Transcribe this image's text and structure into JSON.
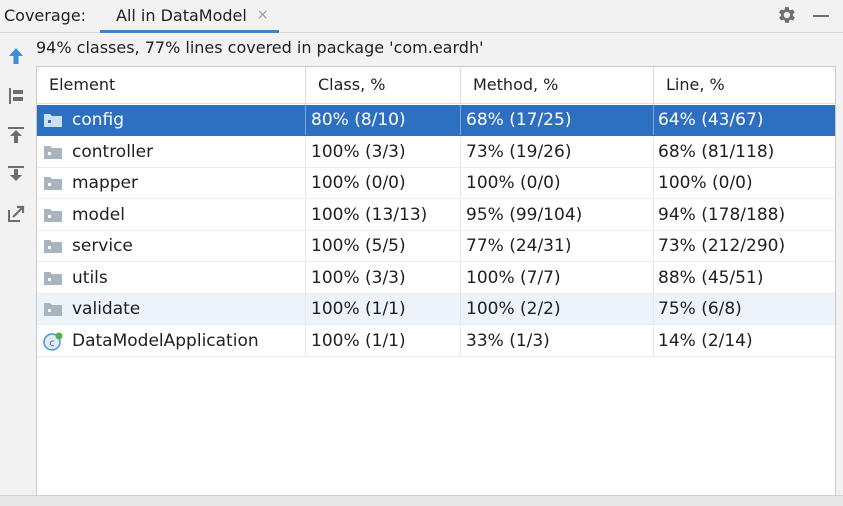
{
  "toolbar": {
    "label": "Coverage:",
    "tab_label": "All in DataModel",
    "tab_close": "×"
  },
  "summary": "94% classes, 77% lines covered in package 'com.eardh'",
  "table": {
    "columns": [
      "Element",
      "Class, %",
      "Method, %",
      "Line, %"
    ],
    "rows": [
      {
        "name": "config",
        "icon": "package-folder-icon",
        "class": "80% (8/10)",
        "method": "68% (17/25)",
        "line": "64% (43/67)",
        "state": "selected"
      },
      {
        "name": "controller",
        "icon": "package-folder-icon",
        "class": "100% (3/3)",
        "method": "73% (19/26)",
        "line": "68% (81/118)",
        "state": ""
      },
      {
        "name": "mapper",
        "icon": "package-folder-icon",
        "class": "100% (0/0)",
        "method": "100% (0/0)",
        "line": "100% (0/0)",
        "state": ""
      },
      {
        "name": "model",
        "icon": "package-folder-icon",
        "class": "100% (13/13)",
        "method": "95% (99/104)",
        "line": "94% (178/188)",
        "state": ""
      },
      {
        "name": "service",
        "icon": "package-folder-icon",
        "class": "100% (5/5)",
        "method": "77% (24/31)",
        "line": "73% (212/290)",
        "state": ""
      },
      {
        "name": "utils",
        "icon": "package-folder-icon",
        "class": "100% (3/3)",
        "method": "100% (7/7)",
        "line": "88% (45/51)",
        "state": ""
      },
      {
        "name": "validate",
        "icon": "package-folder-icon",
        "class": "100% (1/1)",
        "method": "100% (2/2)",
        "line": "75% (6/8)",
        "state": "hover"
      },
      {
        "name": "DataModelApplication",
        "icon": "spring-boot-class-icon",
        "class": "100% (1/1)",
        "method": "33% (1/3)",
        "line": "14% (2/14)",
        "state": ""
      }
    ]
  },
  "sidebar_icons": [
    "navigate-up-icon",
    "flatten-packages-icon",
    "export-top-icon",
    "import-icon",
    "open-external-icon"
  ],
  "colors": {
    "selection": "#2d6fc1",
    "hover": "#edf3fa",
    "accent": "#4083c9"
  }
}
